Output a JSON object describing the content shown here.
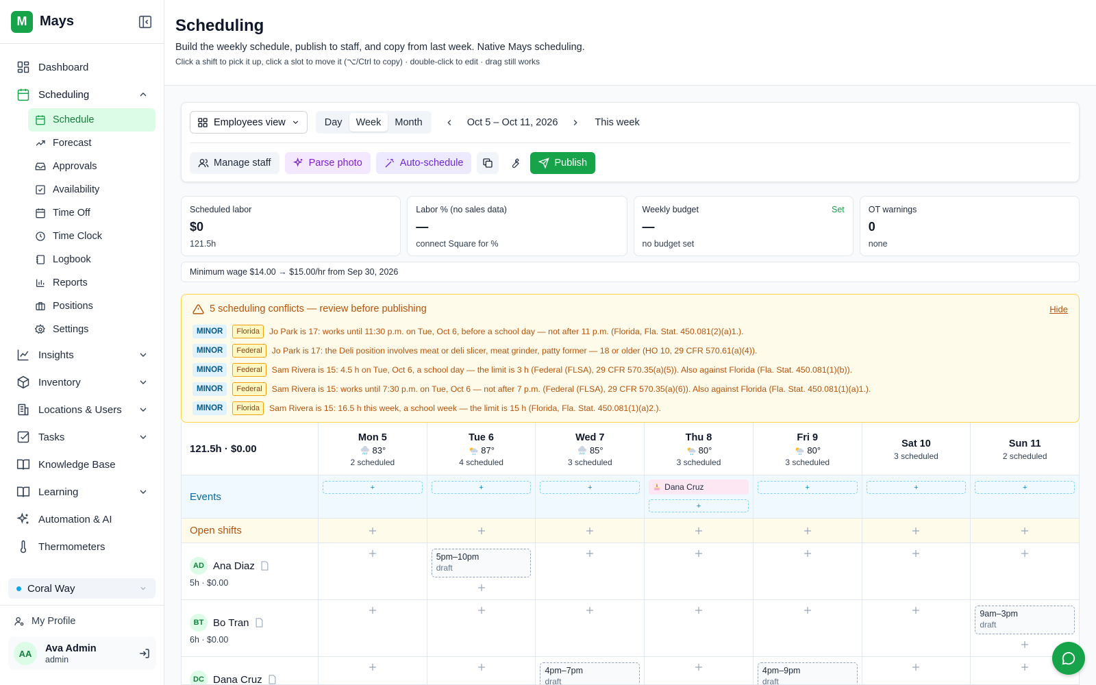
{
  "app": {
    "name": "Mays",
    "logo_letter": "M"
  },
  "colors": {
    "accent": "#16a34a",
    "accent_light": "#dcfce7",
    "warning": "#b45309",
    "info": "#0369a1"
  },
  "sidebar": {
    "nav": [
      {
        "label": "Dashboard",
        "icon": "dashboard-icon"
      },
      {
        "label": "Scheduling",
        "icon": "calendar-icon",
        "expanded": true
      },
      {
        "label": "Insights",
        "icon": "chart-line-icon"
      },
      {
        "label": "Inventory",
        "icon": "box-icon"
      },
      {
        "label": "Locations & Users",
        "icon": "building-icon"
      },
      {
        "label": "Tasks",
        "icon": "checkbox-icon"
      },
      {
        "label": "Knowledge Base",
        "icon": "book-icon"
      },
      {
        "label": "Learning",
        "icon": "book-open-icon"
      },
      {
        "label": "Automation & AI",
        "icon": "sparkles-icon"
      },
      {
        "label": "Thermometers",
        "icon": "thermometer-icon"
      }
    ],
    "sub": [
      {
        "label": "Schedule",
        "icon": "calendar-icon",
        "active": true
      },
      {
        "label": "Forecast",
        "icon": "trending-up-icon"
      },
      {
        "label": "Approvals",
        "icon": "inbox-icon"
      },
      {
        "label": "Availability",
        "icon": "calendar-check-icon"
      },
      {
        "label": "Time Off",
        "icon": "calendar-off-icon"
      },
      {
        "label": "Time Clock",
        "icon": "clock-icon"
      },
      {
        "label": "Logbook",
        "icon": "notebook-icon"
      },
      {
        "label": "Reports",
        "icon": "bar-chart-icon"
      },
      {
        "label": "Positions",
        "icon": "briefcase-icon"
      },
      {
        "label": "Settings",
        "icon": "gear-icon"
      }
    ],
    "location": "Coral Way",
    "profile_link": "My Profile",
    "user": {
      "initials": "AA",
      "name": "Ava Admin",
      "role": "admin"
    }
  },
  "header": {
    "title": "Scheduling",
    "subtitle": "Build the weekly schedule, publish to staff, and copy from last week. Native Mays scheduling.",
    "hint": "Click a shift to pick it up, click a slot to move it (⌥/Ctrl to copy) · double-click to edit · drag still works"
  },
  "toolbar": {
    "view_select": "Employees view",
    "modes": [
      "Day",
      "Week",
      "Month"
    ],
    "active_mode": "Week",
    "range": "Oct 5 – Oct 11, 2026",
    "this_week": "This week",
    "manage_staff": "Manage staff",
    "parse_photo": "Parse photo",
    "auto_schedule": "Auto-schedule",
    "publish": "Publish"
  },
  "stats": [
    {
      "label": "Scheduled labor",
      "value": "$0",
      "sub": "121.5h"
    },
    {
      "label": "Labor % (no sales data)",
      "value": "—",
      "sub": "connect Square for %"
    },
    {
      "label": "Weekly budget",
      "value": "—",
      "sub": "no budget set",
      "link": "Set"
    },
    {
      "label": "OT warnings",
      "value": "0",
      "sub": "none"
    }
  ],
  "min_wage_note": "Minimum wage $14.00 → $15.00/hr from Sep 30, 2026",
  "conflicts": {
    "title": "5 scheduling conflicts — review before publishing",
    "hide": "Hide",
    "items": [
      {
        "level": "MINOR",
        "juris": "Florida",
        "text": "Jo Park is 17: works until 11:30 p.m. on Tue, Oct 6, before a school day — not after 11 p.m. (Florida, Fla. Stat. 450.081(2)(a)1.)."
      },
      {
        "level": "MINOR",
        "juris": "Federal",
        "text": "Jo Park is 17: the Deli position involves meat or deli slicer, meat grinder, patty former — 18 or older (HO 10, 29 CFR 570.61(a)(4))."
      },
      {
        "level": "MINOR",
        "juris": "Federal",
        "text": "Sam Rivera is 15: 4.5 h on Tue, Oct 6, a school day — the limit is 3 h (Federal (FLSA), 29 CFR 570.35(a)(5)). Also against Florida (Fla. Stat. 450.081(1)(b))."
      },
      {
        "level": "MINOR",
        "juris": "Federal",
        "text": "Sam Rivera is 15: works until 7:30 p.m. on Tue, Oct 6 — not after 7 p.m. (Federal (FLSA), 29 CFR 570.35(a)(6)). Also against Florida (Fla. Stat. 450.081(1)(a)1.)."
      },
      {
        "level": "MINOR",
        "juris": "Florida",
        "text": "Sam Rivera is 15: 16.5 h this week, a school week — the limit is 15 h (Florida, Fla. Stat. 450.081(1)(a)2.)."
      }
    ]
  },
  "schedule": {
    "totals": "121.5h · $0.00",
    "days": [
      {
        "name": "Mon 5",
        "weather": "83°",
        "weather_icon": "rain-cloud-icon",
        "count": "2 scheduled"
      },
      {
        "name": "Tue 6",
        "weather": "87°",
        "weather_icon": "sun-rain-icon",
        "count": "4 scheduled"
      },
      {
        "name": "Wed 7",
        "weather": "85°",
        "weather_icon": "rain-cloud-icon",
        "count": "3 scheduled"
      },
      {
        "name": "Thu 8",
        "weather": "80°",
        "weather_icon": "sun-rain-icon",
        "count": "3 scheduled"
      },
      {
        "name": "Fri 9",
        "weather": "80°",
        "weather_icon": "sun-rain-icon",
        "count": "3 scheduled"
      },
      {
        "name": "Sat 10",
        "weather": "",
        "count": "3 scheduled"
      },
      {
        "name": "Sun 11",
        "weather": "",
        "count": "2 scheduled"
      }
    ],
    "events_label": "Events",
    "event_chip": {
      "day": 3,
      "label": "Dana Cruz"
    },
    "open_label": "Open shifts",
    "employees": [
      {
        "initials": "AD",
        "name": "Ana Diaz",
        "hours": "5h · $0.00",
        "shifts": [
          {
            "day": 1,
            "time": "5pm–10pm",
            "status": "draft"
          }
        ]
      },
      {
        "initials": "BT",
        "name": "Bo Tran",
        "hours": "6h · $0.00",
        "shifts": [
          {
            "day": 6,
            "time": "9am–3pm",
            "status": "draft"
          }
        ]
      },
      {
        "initials": "DC",
        "name": "Dana Cruz",
        "hours": "",
        "shifts": [
          {
            "day": 2,
            "time": "4pm–7pm",
            "status": "draft"
          },
          {
            "day": 4,
            "time": "4pm–9pm",
            "status": "draft"
          }
        ]
      }
    ]
  }
}
